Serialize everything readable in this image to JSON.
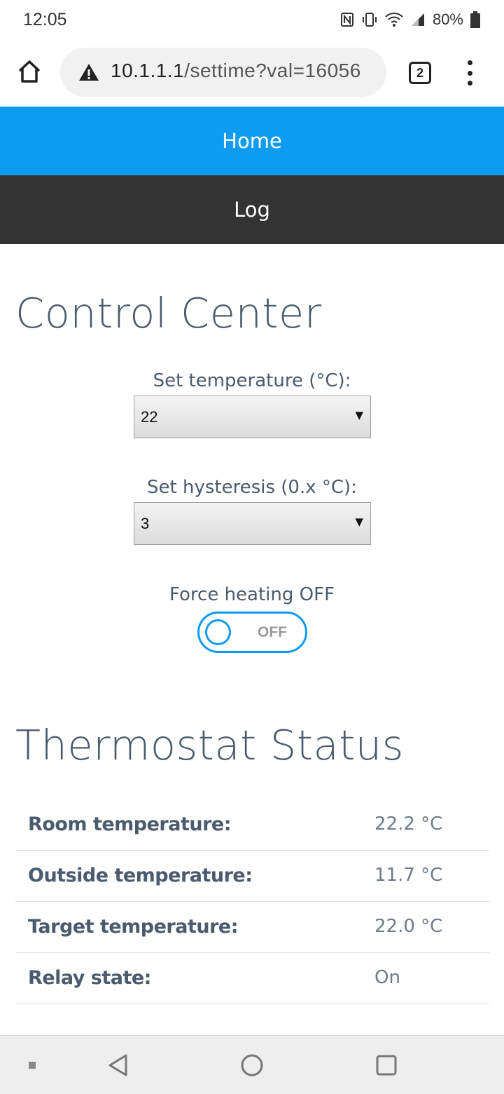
{
  "status_bar": {
    "time": "12:05",
    "battery": "80%",
    "icons": [
      "nfc-icon",
      "vibrate-icon",
      "wifi-icon",
      "signal-icon",
      "battery-icon"
    ]
  },
  "browser": {
    "url_host": "10.1.1.1",
    "url_path": "/settime?val=16056",
    "tab_count": "2",
    "icons": [
      "home-icon",
      "warning-icon",
      "tabs-icon",
      "overflow-menu-icon"
    ]
  },
  "nav": {
    "home": "Home",
    "log": "Log"
  },
  "control_center": {
    "title": "Control Center",
    "temperature_label": "Set temperature (°C):",
    "temperature_value": "22",
    "hysteresis_label": "Set hysteresis (0.x °C):",
    "hysteresis_value": "3",
    "force_heating_label": "Force heating OFF",
    "toggle_state": "OFF"
  },
  "thermostat_status": {
    "title": "Thermostat Status",
    "rows": [
      {
        "label": "Room temperature:",
        "value": "22.2 °C"
      },
      {
        "label": "Outside temperature:",
        "value": "11.7 °C"
      },
      {
        "label": "Target temperature:",
        "value": "22.0 °C"
      },
      {
        "label": "Relay state:",
        "value": "On"
      }
    ]
  },
  "colors": {
    "accent": "#0d9cf0",
    "nav_dark": "#333333",
    "heading": "#4b5b6e"
  }
}
